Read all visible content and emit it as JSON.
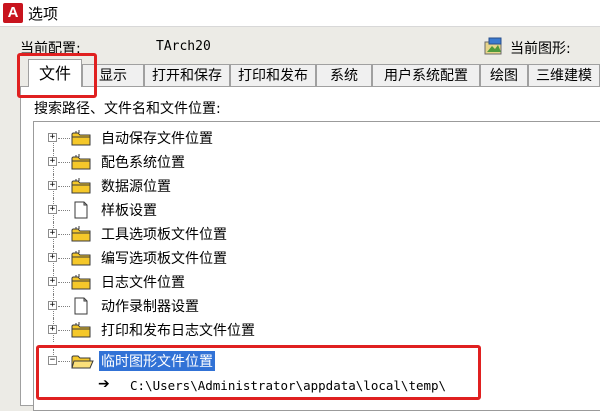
{
  "window": {
    "title": "选项",
    "app_icon_letter": "A",
    "app_icon_color": "#c8141e"
  },
  "config": {
    "current_profile_label": "当前配置:",
    "current_profile_value": "TArch20",
    "current_drawing_label": "当前图形:"
  },
  "tabs": [
    {
      "label": "文件",
      "active": true
    },
    {
      "label": "显示",
      "active": false
    },
    {
      "label": "打开和保存",
      "active": false
    },
    {
      "label": "打印和发布",
      "active": false
    },
    {
      "label": "系统",
      "active": false
    },
    {
      "label": "用户系统配置",
      "active": false
    },
    {
      "label": "绘图",
      "active": false
    },
    {
      "label": "三维建模",
      "active": false
    }
  ],
  "section_label": "搜索路径、文件名和文件位置:",
  "tree": {
    "items": [
      {
        "label": "自动保存文件位置",
        "icon": "folder-icon",
        "expander": "+"
      },
      {
        "label": "配色系统位置",
        "icon": "folder-icon",
        "expander": "+"
      },
      {
        "label": "数据源位置",
        "icon": "folder-icon",
        "expander": "+"
      },
      {
        "label": "样板设置",
        "icon": "document-icon",
        "expander": "+"
      },
      {
        "label": "工具选项板文件位置",
        "icon": "folder-icon",
        "expander": "+"
      },
      {
        "label": "编写选项板文件位置",
        "icon": "folder-icon",
        "expander": "+"
      },
      {
        "label": "日志文件位置",
        "icon": "folder-icon",
        "expander": "+"
      },
      {
        "label": "动作录制器设置",
        "icon": "document-icon",
        "expander": "+"
      },
      {
        "label": "打印和发布日志文件位置",
        "icon": "folder-icon",
        "expander": "+"
      },
      {
        "label": "临时图形文件位置",
        "icon": "folder-icon",
        "expander": "−",
        "selected": true
      }
    ],
    "child": {
      "arrow": "➔",
      "path": "C:\\Users\\Administrator\\appdata\\local\\temp\\"
    }
  },
  "colors": {
    "selection": "#3172d6",
    "annotation": "#e02020",
    "folder": "#f5c82a"
  }
}
